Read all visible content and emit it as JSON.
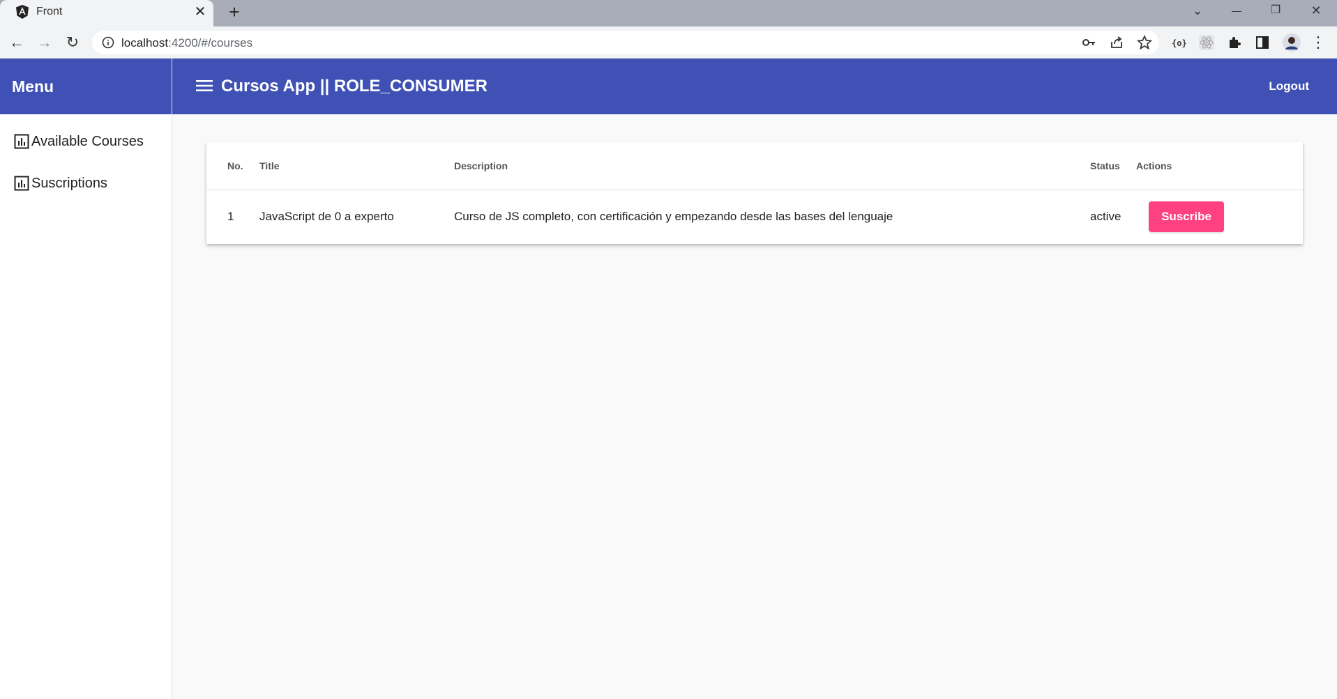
{
  "browser": {
    "tab_title": "Front",
    "tab_close": "✕",
    "new_tab": "+",
    "url_host": "localhost",
    "url_path": ":4200/#/courses",
    "window_controls": {
      "tablist": "⌄",
      "minimize": "—",
      "restore": "❐",
      "close": "✕"
    },
    "nav": {
      "back": "←",
      "forward": "→",
      "reload": "↻"
    },
    "menu_dots": "⋮"
  },
  "sidebar": {
    "title": "Menu",
    "items": [
      {
        "label": "Available Courses",
        "icon": "bar-chart-icon"
      },
      {
        "label": "Suscriptions",
        "icon": "bar-chart-icon"
      }
    ]
  },
  "topbar": {
    "title": "Cursos App || ROLE_CONSUMER",
    "logout_label": "Logout"
  },
  "table": {
    "headers": {
      "no": "No.",
      "title": "Title",
      "description": "Description",
      "status": "Status",
      "actions": "Actions"
    },
    "rows": [
      {
        "no": "1",
        "title": "JavaScript de 0 a experto",
        "description": "Curso de JS completo, con certificación y empezando desde las bases del lenguaje",
        "status": "active",
        "action_label": "Suscribe"
      }
    ]
  },
  "colors": {
    "primary": "#3f51b5",
    "accent": "#ff4081",
    "background": "#f8f9f8"
  }
}
